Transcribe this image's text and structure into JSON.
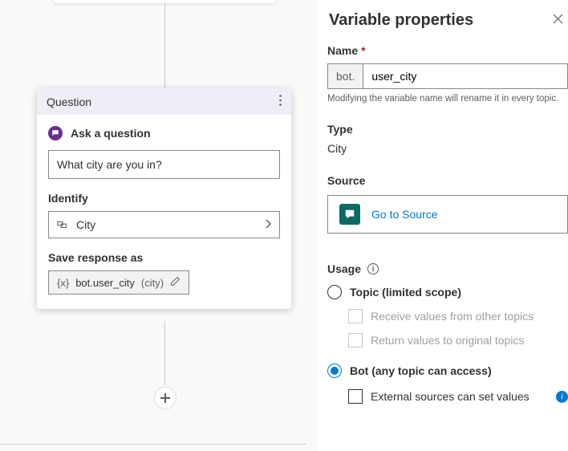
{
  "card": {
    "header": "Question",
    "ask_label": "Ask a question",
    "question_text": "What city are you in?",
    "identify_label": "Identify",
    "identify_value": "City",
    "save_label": "Save response as",
    "var_symbol": "{x}",
    "var_name": "bot.user_city",
    "var_type": "(city)"
  },
  "panel": {
    "title": "Variable properties",
    "name_label": "Name",
    "name_prefix": "bot.",
    "name_value": "user_city",
    "name_helper": "Modifying the variable name will rename it in every topic.",
    "type_label": "Type",
    "type_value": "City",
    "source_label": "Source",
    "source_link": "Go to Source",
    "usage_label": "Usage",
    "usage_topic": "Topic (limited scope)",
    "usage_recv": "Receive values from other topics",
    "usage_return": "Return values to original topics",
    "usage_bot": "Bot (any topic can access)",
    "usage_ext": "External sources can set values"
  }
}
